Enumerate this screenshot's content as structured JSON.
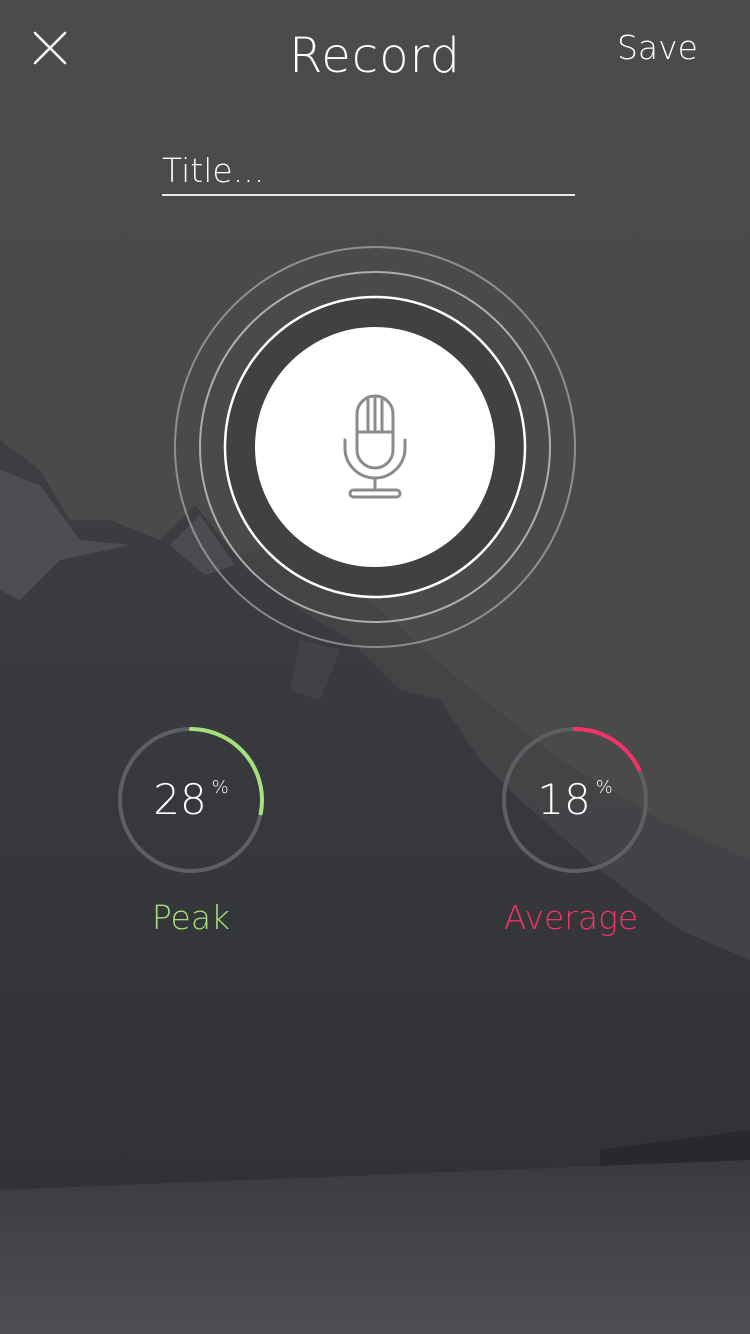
{
  "header": {
    "title": "Record",
    "save_label": "Save",
    "close_icon": "close-icon"
  },
  "title_input": {
    "value": "",
    "placeholder": "Title..."
  },
  "record": {
    "icon": "microphone-icon"
  },
  "meters": {
    "peak": {
      "value": "28",
      "unit": "%",
      "label": "Peak",
      "fraction": 0.28,
      "color": "#a5e07d"
    },
    "average": {
      "value": "18",
      "unit": "%",
      "label": "Average",
      "fraction": 0.18,
      "color": "#f4336a"
    }
  },
  "colors": {
    "background": "#3a3b3e",
    "peak_accent": "#a5e07d",
    "average_accent": "#f4336a"
  }
}
